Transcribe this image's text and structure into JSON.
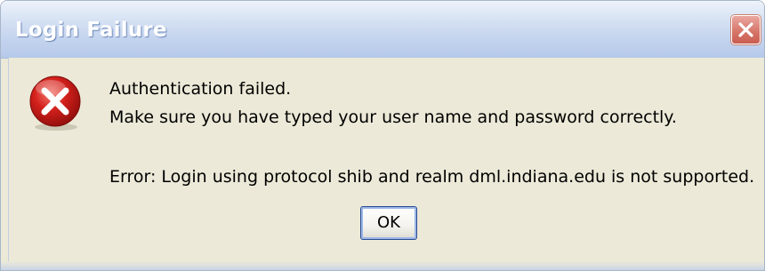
{
  "window": {
    "title": "Login Failure"
  },
  "titlebar": {
    "close_icon": "close-icon"
  },
  "dialog": {
    "icon": "error-icon",
    "message_line1": "Authentication failed.",
    "message_line2": "Make sure you have typed your user name and password correctly.",
    "error_detail": "Error: Login using protocol shib and realm dml.indiana.edu is not supported.",
    "ok_label": "OK"
  },
  "colors": {
    "titlebar": "#c2d3ee",
    "close_button": "#d8776b",
    "error_icon": "#d4211c",
    "dialog_background": "#ece9d8",
    "button_border": "#2a4a92"
  }
}
